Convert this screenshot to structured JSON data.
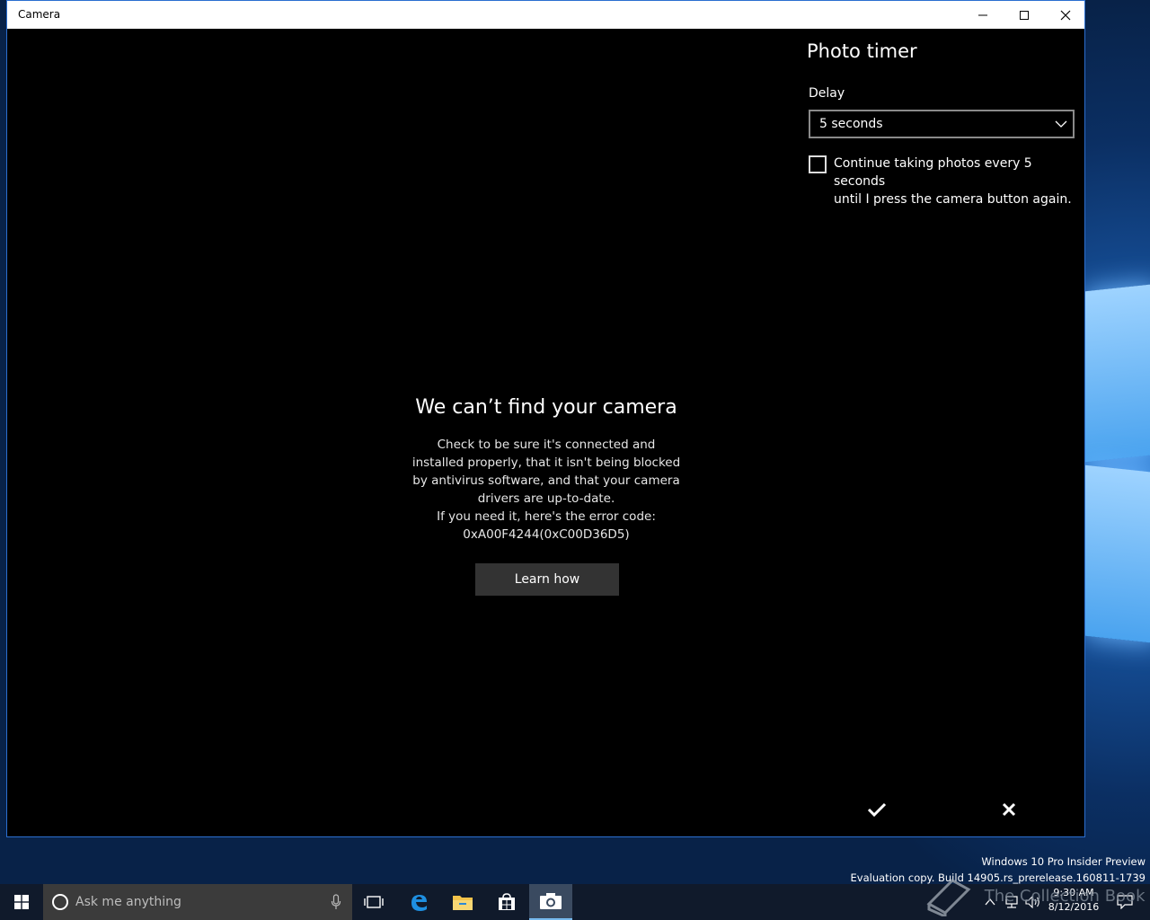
{
  "window": {
    "title": "Camera"
  },
  "error": {
    "title": "We can’t find your camera",
    "lines": [
      "Check to be sure it's connected and",
      "installed properly, that it isn't being blocked",
      "by antivirus software, and that your camera",
      "drivers are up-to-date.",
      "If you need it, here's the error code:",
      "0xA00F4244(0xC00D36D5)"
    ],
    "learn_how_label": "Learn how"
  },
  "photo_timer": {
    "title": "Photo timer",
    "delay_label": "Delay",
    "delay_value": "5 seconds",
    "continuous_checked": false,
    "continuous_label_line1": "Continue taking photos every 5 seconds",
    "continuous_label_line2": "until I press the camera button again."
  },
  "watermark": {
    "line1": "Windows 10 Pro Insider Preview",
    "line2": "Evaluation copy. Build 14905.rs_prerelease.160811-1739"
  },
  "taskbar": {
    "search_placeholder": "Ask me anything",
    "time": "9:30 AM",
    "date": "8/12/2016",
    "overlay_text": "The Collection Book"
  },
  "colors": {
    "accent": "#2b6fd0",
    "taskbar_bg": "#101a2b",
    "button_bg": "#333333"
  }
}
